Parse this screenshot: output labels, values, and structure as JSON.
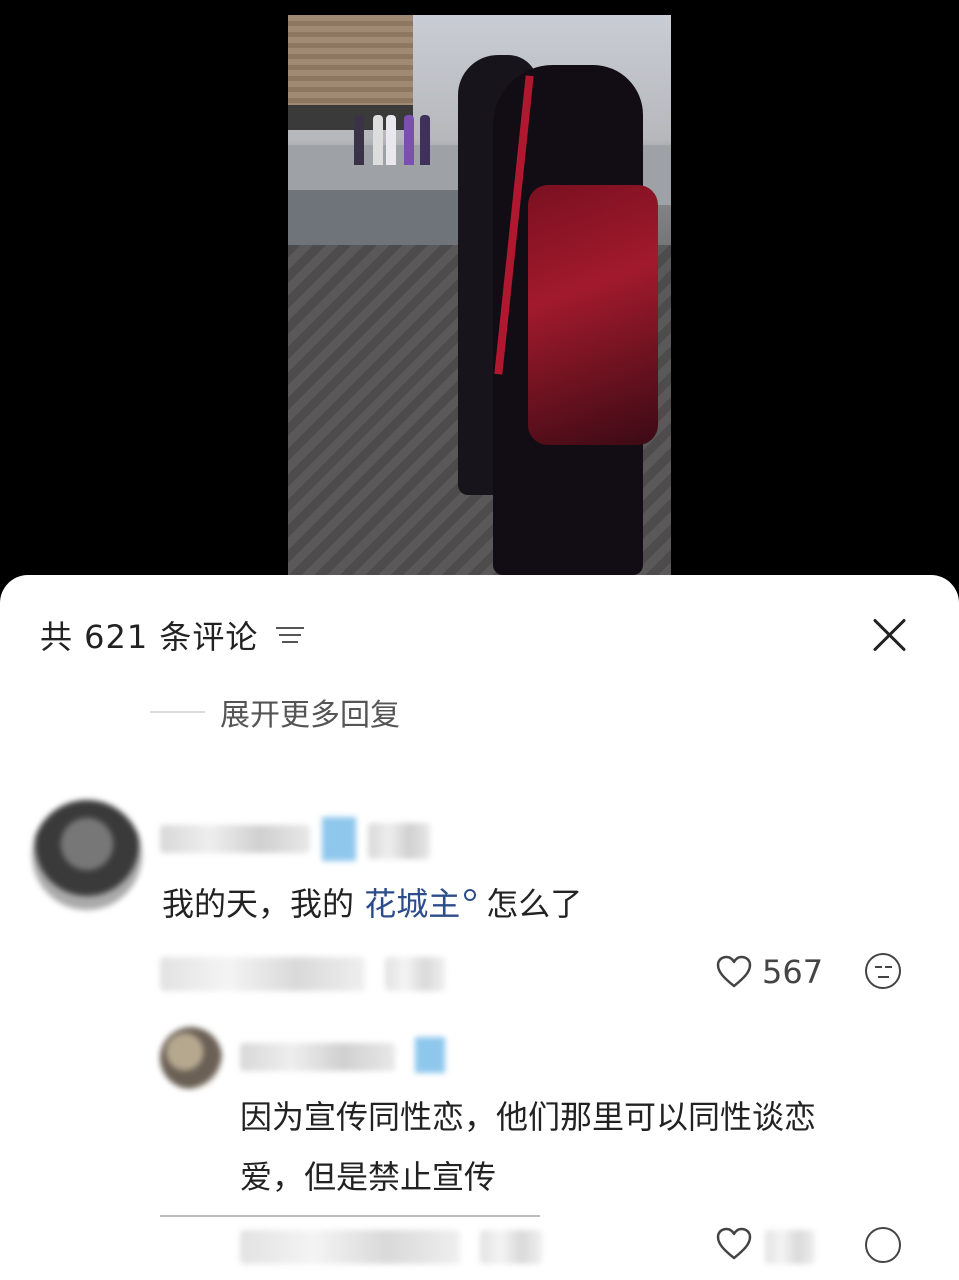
{
  "sheet": {
    "comment_count": "共 621 条评论",
    "expand_replies": "展开更多回复"
  },
  "comments": [
    {
      "text_prefix": "我的天，我的 ",
      "link": "花城主",
      "text_suffix": "怎么了",
      "likes": "567"
    },
    {
      "reply_line1": "因为宣传同性恋，他们那里可以同性谈恋",
      "reply_line2": "爱，但是禁止宣传"
    }
  ],
  "icons": {
    "sort": "sort-lines-icon",
    "close": "close-icon",
    "like": "heart-icon",
    "react": "emoji-icon"
  },
  "colors": {
    "link": "#2c4d8a",
    "sheet_bg": "#ffffff",
    "backdrop": "#000000"
  }
}
